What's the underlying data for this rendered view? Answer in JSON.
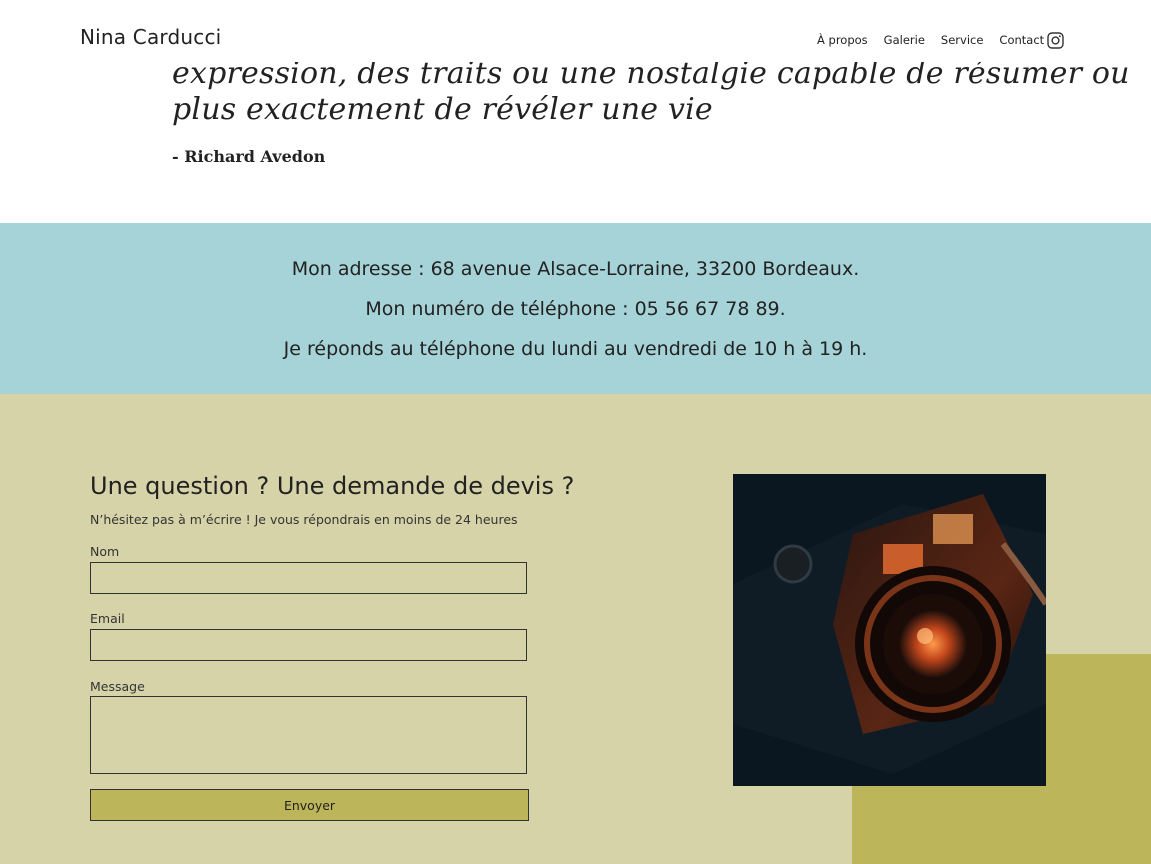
{
  "header": {
    "brand": "Nina Carducci",
    "nav": [
      "À propos",
      "Galerie",
      "Service",
      "Contact"
    ],
    "instagram_icon": "instagram-icon"
  },
  "quote": {
    "line1": "expression, des traits ou une nostalgie capable de résumer ou",
    "line2": "plus exactement de révéler une vie",
    "author": "- Richard Avedon"
  },
  "info": {
    "address": "Mon adresse : 68 avenue Alsace-Lorraine, 33200 Bordeaux.",
    "phone": "Mon numéro de téléphone : 05 56 67 78 89.",
    "hours": "Je réponds au téléphone du lundi au vendredi de 10 h à 19 h."
  },
  "contact_form": {
    "title": "Une question ? Une demande de devis ?",
    "subtitle": "N’hésitez pas à m’écrire ! Je vous répondrais en moins de 24 heures",
    "name_label": "Nom",
    "name_value": "",
    "email_label": "Email",
    "email_value": "",
    "message_label": "Message",
    "message_value": "",
    "submit_label": "Envoyer"
  },
  "colors": {
    "info_bg": "#a6d3d7",
    "contact_bg": "#d7d3a9",
    "accent": "#bdb55a"
  }
}
